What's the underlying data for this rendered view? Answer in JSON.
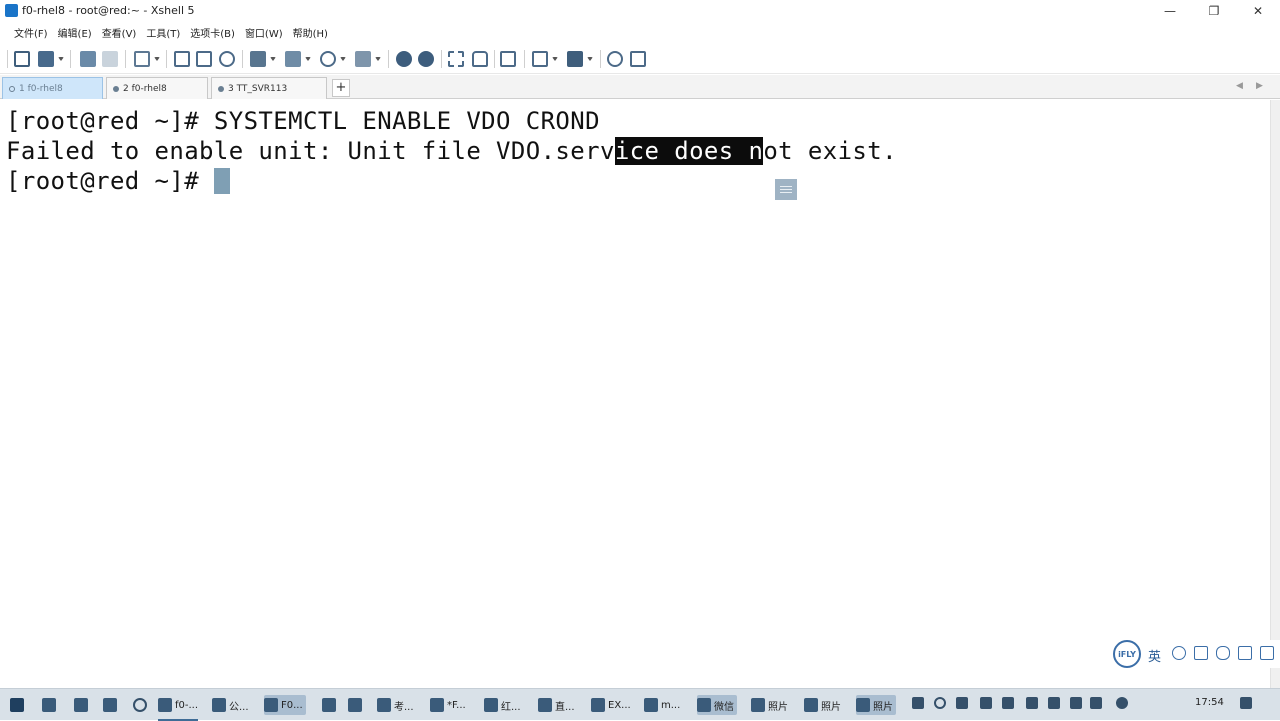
{
  "window": {
    "title": "f0-rhel8 - root@red:~ - Xshell 5",
    "controls": [
      "minimize",
      "restore",
      "close"
    ]
  },
  "menu": [
    "文件(F)",
    "编辑(E)",
    "查看(V)",
    "工具(T)",
    "选项卡(B)",
    "窗口(W)",
    "帮助(H)"
  ],
  "toolbar_icons": [
    "new-session-icon",
    "open-folder-icon",
    "disconnect-icon",
    "reconnect-icon",
    "properties-icon",
    "copy-icon",
    "paste-icon",
    "find-icon",
    "print-icon",
    "transfer-icon",
    "globe-icon",
    "highlight-icon",
    "xftp-icon",
    "tunnel-icon",
    "fullscreen-icon",
    "lock-icon",
    "keyboard-icon",
    "compose-icon",
    "layout-icon",
    "help-icon",
    "chat-icon"
  ],
  "tabs": [
    {
      "label": "1 f0-rhel8",
      "active": true
    },
    {
      "label": "2 f0-rhel8",
      "active": false
    },
    {
      "label": "3 TT_SVR113",
      "active": false
    }
  ],
  "tab_add": "+",
  "tab_nav": {
    "prev": "◀",
    "next": "▶"
  },
  "terminal": {
    "line1": "[root@red ~]# SYSTEMCTL ENABLE VDO CROND",
    "line2_before": "Failed to enable unit: Unit file VDO.serv",
    "line2_selected": "ice does n",
    "line2_after": "ot exist.",
    "line3": "[root@red ~]# "
  },
  "ime": {
    "logo": "iFLY",
    "mode": "英"
  },
  "taskbar": {
    "items": [
      "f0-...",
      "公...",
      "F0...",
      "考...",
      "*F...",
      "红...",
      "直...",
      "EX...",
      "m...",
      "微信",
      "照片",
      "照片",
      "照片"
    ],
    "time": "17:54"
  }
}
